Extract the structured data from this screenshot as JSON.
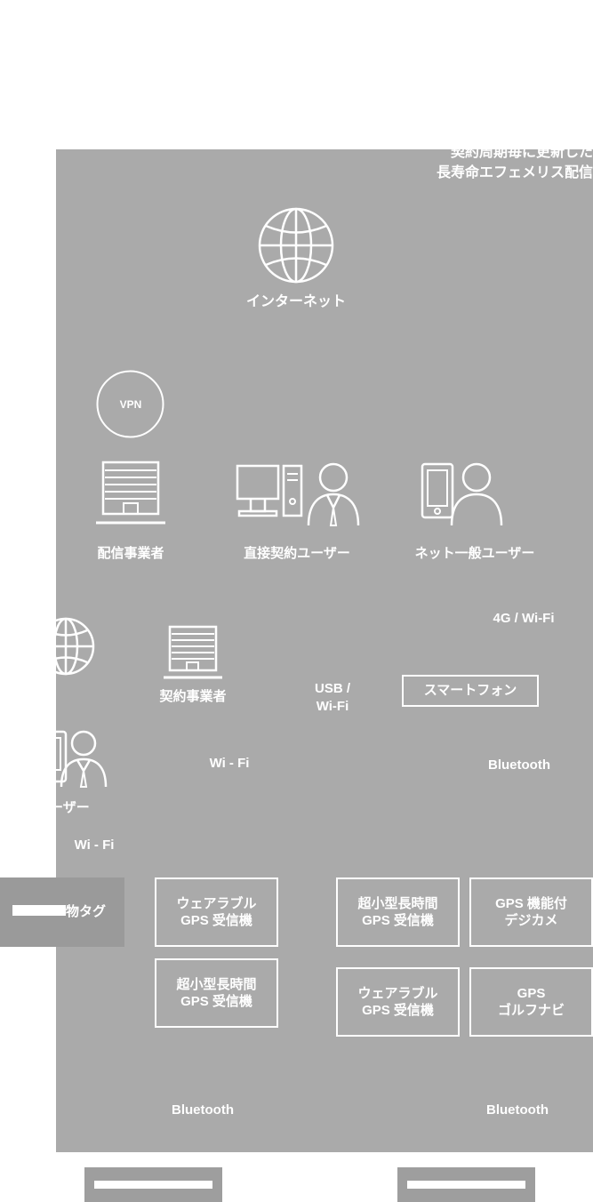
{
  "diagram": {
    "panel_color": "#aaaaaa",
    "text_color": "#ffffff",
    "header": {
      "line1": "契約周期毎に更新した",
      "line2": "長寿命エフェメリス配信"
    },
    "nodes": {
      "internet": "インターネット",
      "vpn": "VPN",
      "distributor": "配信事業者",
      "direct_user": "直接契約ユーザー",
      "net_user": "ネット一般ユーザー",
      "contract_operator": "契約事業者",
      "clipped_user": "ーザー",
      "clipped_tag": "物タグ"
    },
    "link_labels": {
      "fourg_wifi": "4G / Wi-Fi",
      "usb_wifi": "USB /\nWi-Fi",
      "usb_wifi_line1": "USB /",
      "usb_wifi_line2": "Wi-Fi",
      "wifi_mid": "Wi - Fi",
      "bluetooth_right_top": "Bluetooth",
      "wifi_left": "Wi - Fi",
      "bluetooth_bottom_left": "Bluetooth",
      "bluetooth_bottom_right": "Bluetooth"
    },
    "devices": [
      {
        "id": "smartphone",
        "line1": "スマートフォン",
        "line2": ""
      },
      {
        "id": "wearable-gps-1",
        "line1": "ウェアラブル",
        "line2": "GPS 受信機"
      },
      {
        "id": "ultracompact-gps-1",
        "line1": "超小型長時間",
        "line2": "GPS 受信機"
      },
      {
        "id": "gps-digital-camera",
        "line1": "GPS 機能付",
        "line2": "デジカメ"
      },
      {
        "id": "ultracompact-gps-2",
        "line1": "超小型長時間",
        "line2": "GPS 受信機"
      },
      {
        "id": "wearable-gps-2",
        "line1": "ウェアラブル",
        "line2": "GPS 受信機"
      },
      {
        "id": "gps-golf-navi",
        "line1": "GPS",
        "line2": "ゴルフナビ"
      }
    ],
    "footer_buttons": [
      {
        "id": "footer-button-left",
        "label": ""
      },
      {
        "id": "footer-button-right",
        "label": ""
      }
    ]
  }
}
